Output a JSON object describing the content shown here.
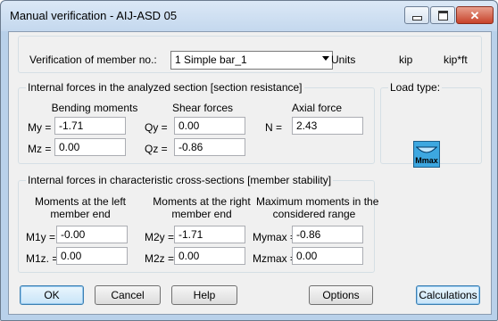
{
  "window": {
    "title": "Manual verification - AIJ-ASD 05"
  },
  "header": {
    "verification_label": "Verification of member no.:",
    "member_selected": "1 Simple bar_1",
    "units_label": "Units",
    "unit_force": "kip",
    "unit_moment": "kip*ft"
  },
  "section_resistance": {
    "title": "Internal forces in the analyzed section [section resistance]",
    "bending_header": "Bending moments",
    "shear_header": "Shear forces",
    "axial_header": "Axial force",
    "my_label": "My =",
    "my_value": "-1.71",
    "mz_label": "Mz =",
    "mz_value": "0.00",
    "qy_label": "Qy =",
    "qy_value": "0.00",
    "qz_label": "Qz =",
    "qz_value": "-0.86",
    "n_label": "N =",
    "n_value": "2.43"
  },
  "load_type": {
    "title": "Load type:",
    "icon_text": "Mmax"
  },
  "member_stability": {
    "title": "Internal forces in characteristic cross-sections [member stability]",
    "left_header_1": "Moments at the left",
    "left_header_2": "member end",
    "right_header_1": "Moments at the right",
    "right_header_2": "member end",
    "max_header_1": "Maximum moments in the",
    "max_header_2": "considered range",
    "m1y_label": "M1y =",
    "m1y_value": "-0.00",
    "m1z_label": "M1z. =",
    "m1z_value": "0.00",
    "m2y_label": "M2y =",
    "m2y_value": "-1.71",
    "m2z_label": "M2z =",
    "m2z_value": "0.00",
    "mymax_label": "Mymax =",
    "mymax_value": "-0.86",
    "mzmax_label": "Mzmax =",
    "mzmax_value": "0.00"
  },
  "buttons": {
    "ok": "OK",
    "cancel": "Cancel",
    "help": "Help",
    "options": "Options",
    "calculations": "Calculations"
  }
}
